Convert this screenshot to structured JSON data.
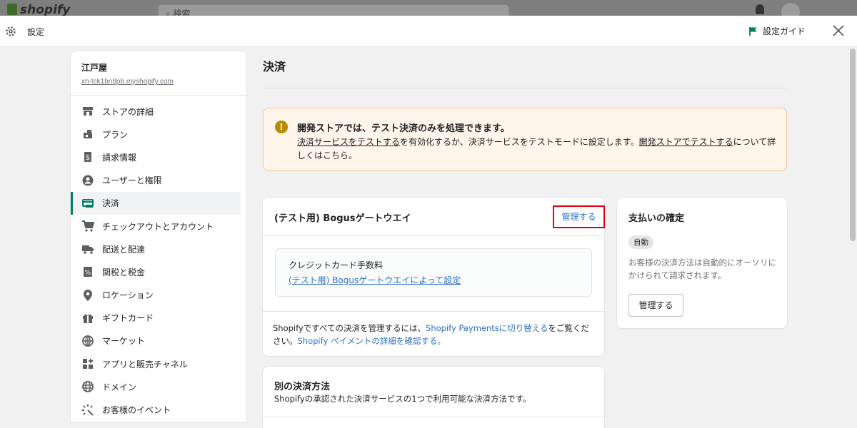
{
  "backdrop": {
    "logo": "shopify",
    "search_placeholder": "検索"
  },
  "header": {
    "title": "設定",
    "guide_label": "設定ガイド",
    "icons": [
      "gear-icon",
      "flag-icon",
      "close-icon"
    ]
  },
  "sidebar": {
    "store_name": "江戸屋",
    "store_url": "xn-tck1bn8pb.myshopify.com",
    "items": [
      {
        "label": "ストアの詳細",
        "icon": "store-icon"
      },
      {
        "label": "プラン",
        "icon": "plan-icon"
      },
      {
        "label": "請求情報",
        "icon": "billing-icon"
      },
      {
        "label": "ユーザーと権限",
        "icon": "user-icon"
      },
      {
        "label": "決済",
        "icon": "payment-icon",
        "active": true
      },
      {
        "label": "チェックアウトとアカウント",
        "icon": "cart-icon"
      },
      {
        "label": "配送と配達",
        "icon": "truck-icon"
      },
      {
        "label": "関税と税金",
        "icon": "tax-icon"
      },
      {
        "label": "ロケーション",
        "icon": "location-icon"
      },
      {
        "label": "ギフトカード",
        "icon": "gift-icon"
      },
      {
        "label": "マーケット",
        "icon": "globe-icon"
      },
      {
        "label": "アプリと販売チャネル",
        "icon": "apps-icon"
      },
      {
        "label": "ドメイン",
        "icon": "domain-icon"
      },
      {
        "label": "お客様のイベント",
        "icon": "events-icon"
      }
    ]
  },
  "main": {
    "title": "決済",
    "banner": {
      "title": "開発ストアでは、テスト決済のみを処理できます。",
      "link1": "決済サービスをテストする",
      "text1": "を有効化するか、決済サービスをテストモードに設定します。",
      "link2": "開発ストアでテストする",
      "text2": "について詳しくはこちら。"
    },
    "gateway": {
      "title": "(テスト用) Bogusゲートウエイ",
      "manage_label": "管理する",
      "fee_label": "クレジットカード手数料",
      "fee_link": "(テスト用) Bogusゲートウエイによって設定",
      "foot_text1": "Shopifyですべての決済を管理するには、",
      "foot_link1": "Shopify Paymentsに切り替える",
      "foot_text2": "をご覧ください。",
      "foot_link2": "Shopify ペイメントの詳細を確認する。"
    },
    "confirm": {
      "title": "支払いの確定",
      "badge": "自動",
      "text": "お客様の決済方法は自動的にオーソリにかけられて請求されます。",
      "button": "管理する"
    },
    "alt": {
      "title": "別の決済方法",
      "subtitle": "Shopifyの承認された決済サービスの1つで利用可能な決済方法です。"
    }
  },
  "colors": {
    "accent": "#008060",
    "link": "#2c6ecb",
    "highlight_border": "#e2000f",
    "banner_bg": "#fff5ea"
  }
}
